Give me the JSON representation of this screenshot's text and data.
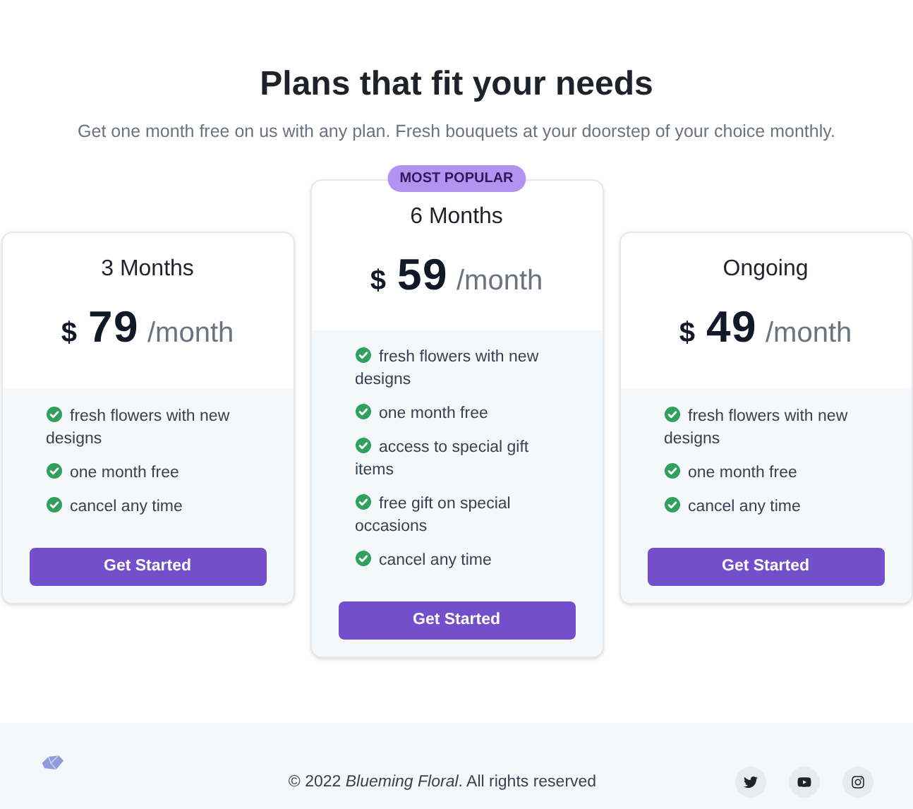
{
  "header": {
    "title": "Plans that fit your needs",
    "subtitle": "Get one month free on us with any plan. Fresh bouquets at your doorstep of your choice monthly."
  },
  "plans": [
    {
      "name": "3 Months",
      "currency": "$",
      "price": "79",
      "period": "/month",
      "featured": false,
      "features": [
        "fresh flowers with new designs",
        "one month free",
        "cancel any time"
      ],
      "button": "Get Started"
    },
    {
      "name": "6 Months",
      "badge": "MOST POPULAR",
      "currency": "$",
      "price": "59",
      "period": "/month",
      "featured": true,
      "features": [
        "fresh flowers with new designs",
        "one month free",
        "access to special gift items",
        "free gift on special occasions",
        "cancel any time"
      ],
      "button": "Get Started"
    },
    {
      "name": "Ongoing",
      "currency": "$",
      "price": "49",
      "period": "/month",
      "featured": false,
      "features": [
        "fresh flowers with new designs",
        "one month free",
        "cancel any time"
      ],
      "button": "Get Started"
    }
  ],
  "footer": {
    "copyright_prefix": "© 2022 ",
    "brand": "Blueming Floral",
    "copyright_suffix": ". All rights reserved",
    "social": [
      {
        "kind": "twitter"
      },
      {
        "kind": "youtube"
      },
      {
        "kind": "instagram"
      }
    ]
  }
}
